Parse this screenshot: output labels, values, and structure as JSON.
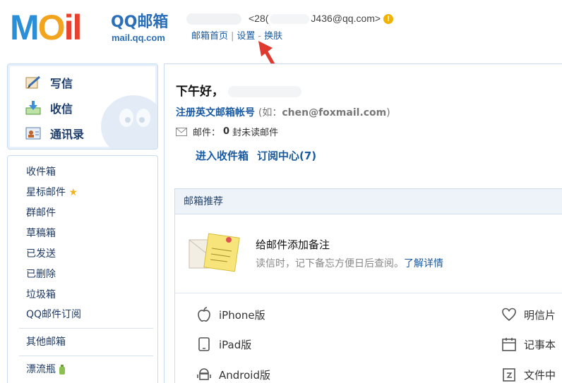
{
  "header": {
    "logo_mark": "MOil",
    "brand_name": "QQ邮箱",
    "brand_domain": "mail.qq.com",
    "account_prefix": "<28(",
    "account_suffix": "J436@qq.com>",
    "warning_badge": "!",
    "links": {
      "home": "邮箱首页",
      "sep1": "|",
      "settings": "设置",
      "sep2": "-",
      "skin": "换肤"
    }
  },
  "actions": {
    "compose": "写信",
    "inbox_check": "收信",
    "contacts": "通讯录"
  },
  "folders": {
    "inbox": "收件箱",
    "starred": "星标邮件",
    "group": "群邮件",
    "drafts": "草稿箱",
    "sent": "已发送",
    "deleted": "已删除",
    "spam": "垃圾箱",
    "subscriptions": "QQ邮件订阅",
    "other": "其他邮箱",
    "bottle": "漂流瓶"
  },
  "main": {
    "greeting": "下午好，",
    "register_link": "注册英文邮箱帐号",
    "register_hint_open": "(如：",
    "register_hint_email": "chen@foxmail.com",
    "register_hint_close": ")",
    "mail_label": "邮件：",
    "unread_count": "0",
    "unread_text": "封未读邮件",
    "enter_inbox": "进入收件箱",
    "subscription_center": "订阅中心(7)"
  },
  "recommend": {
    "title": "邮箱推荐",
    "item_title": "给邮件添加备注",
    "item_desc": "读信时，记下备忘方便日后查阅。",
    "item_more": "了解详情"
  },
  "apps": {
    "iphone": "iPhone版",
    "ipad": "iPad版",
    "android": "Android版",
    "postcard": "明信片",
    "notes": "记事本",
    "files": "文件中"
  },
  "colors": {
    "brand_blue": "#2b8fd8",
    "link": "#1a5aa0",
    "panel_border": "#c9dbee",
    "annotation_arrow": "#e03a2e"
  }
}
